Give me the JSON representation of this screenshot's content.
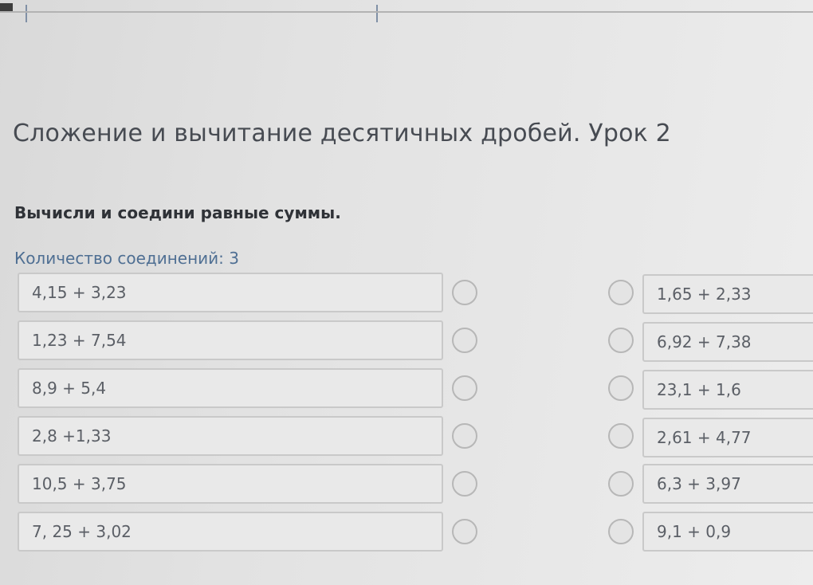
{
  "title": "Сложение и вычитание десятичных дробей. Урок 2",
  "instruction": "Вычисли и соедини равные суммы.",
  "connections_count": "Количество соединений: 3",
  "left_items": [
    "4,15 + 3,23",
    "1,23 + 7,54",
    "8,9 + 5,4",
    "2,8 +1,33",
    "10,5 + 3,75",
    "7, 25 + 3,02"
  ],
  "right_items": [
    "1,65 + 2,33",
    "6,92 + 7,38",
    "23,1 + 1,6",
    "2,61 + 4,77",
    "6,3 + 3,97",
    "9,1 + 0,9"
  ]
}
